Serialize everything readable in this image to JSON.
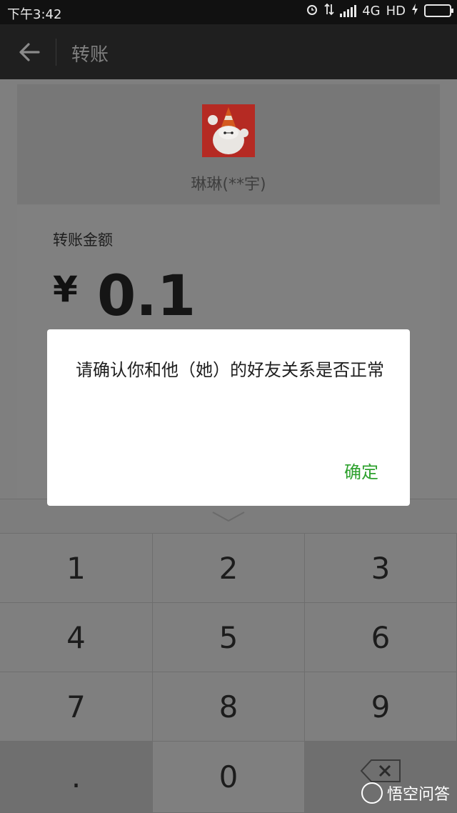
{
  "status_bar": {
    "time": "下午3:42",
    "network": "4G",
    "hd": "HD",
    "icons": [
      "alarm-icon",
      "data-arrows-icon",
      "signal-icon",
      "charging-icon",
      "battery-icon"
    ]
  },
  "header": {
    "title": "转账",
    "back_icon": "arrow-left-icon"
  },
  "payee": {
    "name": "琳琳(**宇)"
  },
  "amount": {
    "label": "转账金额",
    "currency": "¥",
    "value": "0.1"
  },
  "keypad": {
    "keys": [
      "1",
      "2",
      "3",
      "4",
      "5",
      "6",
      "7",
      "8",
      "9",
      ".",
      "0"
    ],
    "backspace_icon": "backspace-icon",
    "collapse_icon": "chevron-down-icon"
  },
  "dialog": {
    "message": "请确认你和他（她）的好友关系是否正常",
    "confirm_label": "确定"
  },
  "watermark": {
    "text": "悟空问答"
  },
  "colors": {
    "accent": "#2ea12e",
    "header_bg": "#1f1f1f",
    "battery": "#5bd22a"
  }
}
